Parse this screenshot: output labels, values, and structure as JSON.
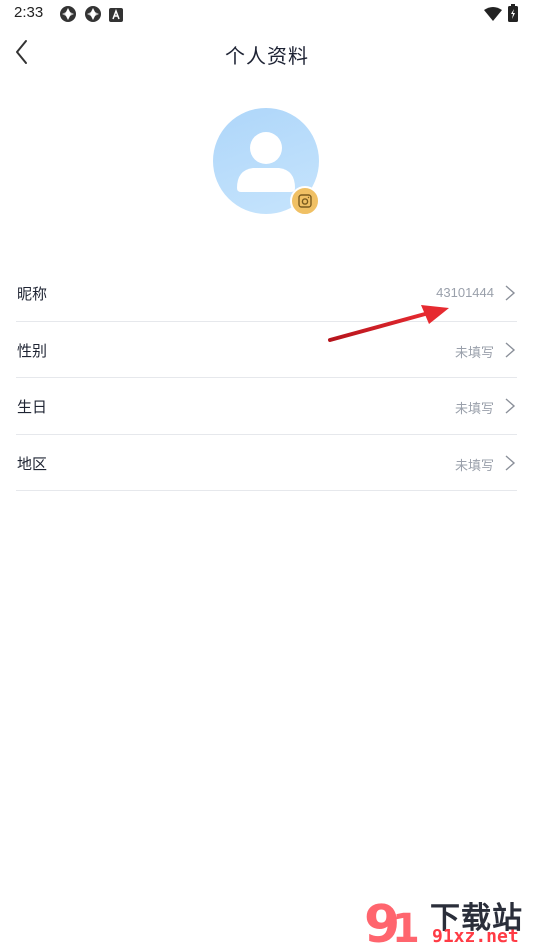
{
  "status_bar": {
    "time": "2:33",
    "icons": [
      "app-notification-icon",
      "app-notification-icon",
      "a-icon"
    ],
    "right_icons": [
      "wifi-icon",
      "battery-icon"
    ]
  },
  "header": {
    "title": "个人资料",
    "back_icon": "chevron-left-icon"
  },
  "avatar": {
    "placeholder_icon": "user-silhouette-icon",
    "camera_icon": "camera-icon",
    "badge_color": "#f0c064"
  },
  "profile_rows": [
    {
      "label": "昵称",
      "value": "43101444"
    },
    {
      "label": "性别",
      "value": "未填写"
    },
    {
      "label": "生日",
      "value": "未填写"
    },
    {
      "label": "地区",
      "value": "未填写"
    }
  ],
  "watermark": {
    "logo_text": "下载站",
    "url": "91xz.net",
    "logo_mark": "91"
  },
  "colors": {
    "accent": "#f0c064",
    "annotation_arrow": "#d61f26",
    "avatar_bg": "#b9dcfb"
  }
}
